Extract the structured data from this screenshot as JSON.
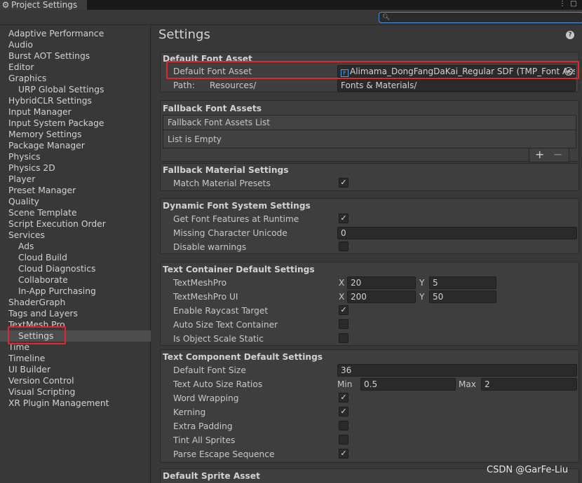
{
  "window": {
    "tab_title": "Project Settings"
  },
  "sidebar": {
    "items": [
      {
        "label": "Adaptive Performance"
      },
      {
        "label": "Audio"
      },
      {
        "label": "Burst AOT Settings"
      },
      {
        "label": "Editor"
      },
      {
        "label": "Graphics"
      },
      {
        "label": "URP Global Settings"
      },
      {
        "label": "HybridCLR Settings"
      },
      {
        "label": "Input Manager"
      },
      {
        "label": "Input System Package"
      },
      {
        "label": "Memory Settings"
      },
      {
        "label": "Package Manager"
      },
      {
        "label": "Physics"
      },
      {
        "label": "Physics 2D"
      },
      {
        "label": "Player"
      },
      {
        "label": "Preset Manager"
      },
      {
        "label": "Quality"
      },
      {
        "label": "Scene Template"
      },
      {
        "label": "Script Execution Order"
      },
      {
        "label": "Services"
      },
      {
        "label": "Ads"
      },
      {
        "label": "Cloud Build"
      },
      {
        "label": "Cloud Diagnostics"
      },
      {
        "label": "Collaborate"
      },
      {
        "label": "In-App Purchasing"
      },
      {
        "label": "ShaderGraph"
      },
      {
        "label": "Tags and Layers"
      },
      {
        "label": "TextMesh Pro"
      },
      {
        "label": "Settings"
      },
      {
        "label": "Time"
      },
      {
        "label": "Timeline"
      },
      {
        "label": "UI Builder"
      },
      {
        "label": "Version Control"
      },
      {
        "label": "Visual Scripting"
      },
      {
        "label": "XR Plugin Management"
      }
    ],
    "selected": "Settings"
  },
  "main": {
    "title": "Settings",
    "default_font": {
      "section_title": "Default Font Asset",
      "label": "Default Font Asset",
      "value": "Alimama_DongFangDaKai_Regular SDF (TMP_Font Ass",
      "path_label": "Path:",
      "path_prefix": "Resources/",
      "path_value": "Fonts & Materials/"
    },
    "fallback_fonts": {
      "section_title": "Fallback Font Assets",
      "list_header": "Fallback Font Assets List",
      "list_empty": "List is Empty",
      "add": "+",
      "remove": "−"
    },
    "fallback_material": {
      "section_title": "Fallback Material Settings",
      "match_presets_label": "Match Material Presets",
      "match_presets": true
    },
    "dynamic_font": {
      "section_title": "Dynamic Font System Settings",
      "get_features_label": "Get Font Features at Runtime",
      "get_features": true,
      "missing_char_label": "Missing Character Unicode",
      "missing_char": "0",
      "disable_warnings_label": "Disable warnings",
      "disable_warnings": false
    },
    "text_container": {
      "section_title": "Text Container Default Settings",
      "tmp_label": "TextMeshPro",
      "tmp_x": "20",
      "tmp_y": "5",
      "tmpui_label": "TextMeshPro UI",
      "tmpui_x": "200",
      "tmpui_y": "50",
      "x_label": "X",
      "y_label": "Y",
      "raycast_label": "Enable Raycast Target",
      "raycast": true,
      "autosize_label": "Auto Size Text Container",
      "autosize": false,
      "scale_static_label": "Is Object Scale Static",
      "scale_static": false
    },
    "text_component": {
      "section_title": "Text Component Default Settings",
      "font_size_label": "Default Font Size",
      "font_size": "36",
      "ratios_label": "Text Auto Size Ratios",
      "min_label": "Min",
      "min": "0.5",
      "max_label": "Max",
      "max": "2",
      "word_wrap_label": "Word Wrapping",
      "word_wrap": true,
      "kerning_label": "Kerning",
      "kerning": true,
      "extra_padding_label": "Extra Padding",
      "extra_padding": false,
      "tint_sprites_label": "Tint All Sprites",
      "tint_sprites": false,
      "escape_label": "Parse Escape Sequence",
      "escape": true
    },
    "sprite_asset": {
      "section_title": "Default Sprite Asset"
    }
  },
  "icons": {
    "gear": "gear-icon",
    "help": "help-icon",
    "search": "search-icon",
    "font": "font-asset-icon",
    "picker": "object-picker-icon"
  },
  "watermark": "CSDN @GarFe-Liu",
  "colors": {
    "highlight": "#e3262e",
    "accent": "#4a8fd8"
  }
}
